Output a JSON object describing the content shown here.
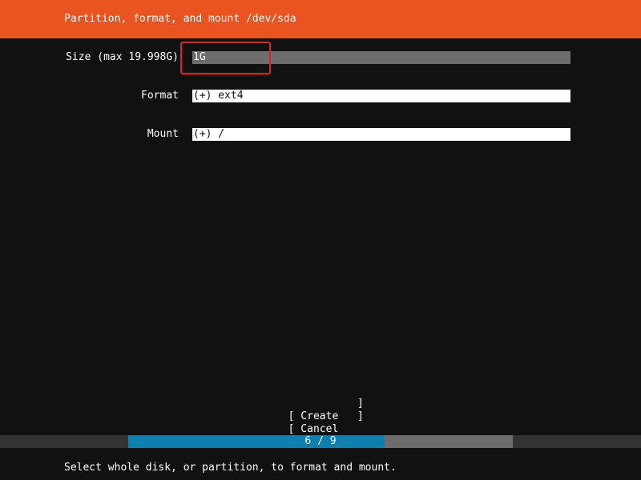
{
  "header": {
    "title": "Partition, format, and mount /dev/sda"
  },
  "form": {
    "size": {
      "label": "Size (max 19.998G)",
      "value": "1G"
    },
    "format": {
      "label": "Format",
      "value": "(+) ext4"
    },
    "mount": {
      "label": "Mount",
      "value": "(+) /"
    }
  },
  "buttons": {
    "create": {
      "label": "[ Create",
      "close": "]"
    },
    "cancel": {
      "label": "[ Cancel",
      "close": "]"
    }
  },
  "progress": {
    "text": "6 / 9",
    "current": 6,
    "total": 9
  },
  "footer": {
    "hint": "Select whole disk, or partition, to format and mount."
  },
  "colors": {
    "header_bg": "#e95420",
    "background": "#111111",
    "progress_fill": "#0e7fae",
    "progress_track": "#6d6d6d",
    "highlight_border": "#e02424"
  }
}
